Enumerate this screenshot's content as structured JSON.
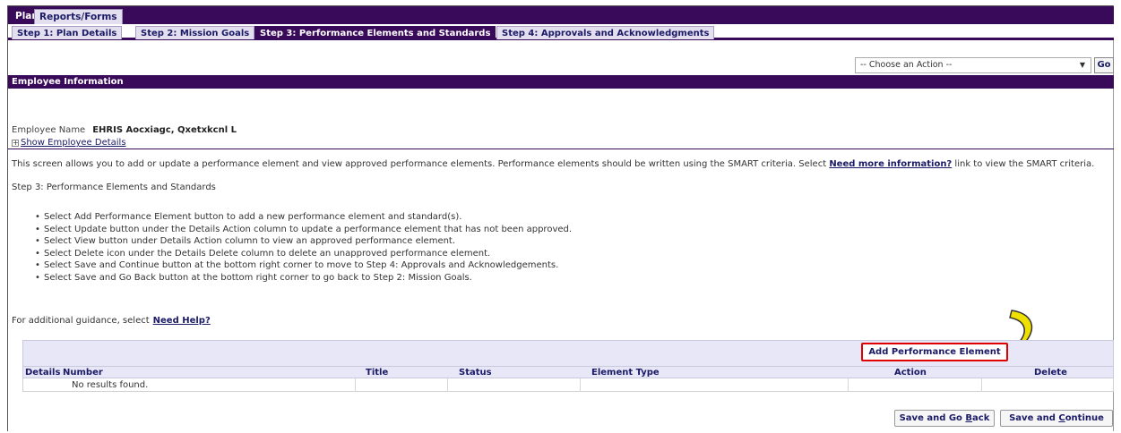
{
  "topnav": {
    "tabs": [
      {
        "label": "Plan"
      },
      {
        "label": "Reports/Forms"
      }
    ]
  },
  "steps": [
    {
      "label": "Step 1: Plan Details"
    },
    {
      "label": "Step 2: Mission Goals"
    },
    {
      "label": "Step 3: Performance Elements and Standards"
    },
    {
      "label": "Step 4: Approvals and Acknowledgments"
    }
  ],
  "actions": {
    "select_value": "-- Choose an Action --",
    "go_label": "Go"
  },
  "employee": {
    "section_title": "Employee Information",
    "name_label": "Employee Name",
    "name_value": "EHRIS Aocxiagc, Qxetxkcnl L",
    "expand_symbol": "+",
    "details_link": "Show Employee Details"
  },
  "intro": {
    "text_before": "This screen allows you to add or update a performance element and view approved performance elements. Performance elements should be written using the SMART criteria. Select ",
    "link": "Need more information?",
    "text_after": " link to view the SMART criteria."
  },
  "step_heading": "Step 3: Performance Elements and Standards",
  "instructions": [
    "Select Add Performance Element button to add a new performance element and standard(s).",
    "Select Update button under the Details Action column to update a performance element that has not been approved.",
    "Select View button under Details Action column to view an approved performance element.",
    "Select Delete icon under the Details Delete column to delete an unapproved performance element.",
    "Select Save and Continue button at the bottom right corner to move to Step 4: Approvals and Acknowledgements.",
    "Select Save and Go Back button at the bottom right corner to go back to Step 2: Mission Goals."
  ],
  "guidance": {
    "text": "For additional guidance, select",
    "link": "Need Help?"
  },
  "table": {
    "add_button": "Add Performance Element",
    "columns": [
      "Details",
      "Number",
      "Title",
      "Status",
      "Element Type",
      "Action",
      "Delete"
    ],
    "empty_message": "No results found."
  },
  "footer": {
    "back_prefix": "Save and Go ",
    "back_accel": "B",
    "back_suffix": "ack",
    "continue_prefix": "Save and ",
    "continue_accel": "C",
    "continue_suffix": "ontinue"
  },
  "colors": {
    "header": "#3a0a5a",
    "highlight": "#e00000",
    "arrow": "#f0e000"
  }
}
